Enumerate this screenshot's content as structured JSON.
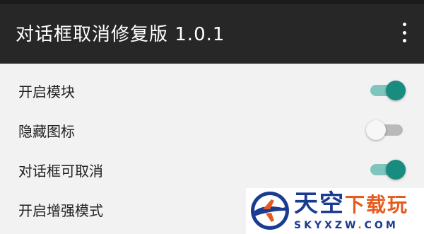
{
  "header": {
    "title": "对话框取消修复版 1.0.1",
    "overflow_icon": "more-vert-icon"
  },
  "settings": [
    {
      "label": "开启模块",
      "enabled": true
    },
    {
      "label": "隐藏图标",
      "enabled": false
    },
    {
      "label": "对话框可取消",
      "enabled": true
    },
    {
      "label": "开启增强模式",
      "enabled": null
    }
  ],
  "watermark": {
    "brand_cn_a": "天空",
    "brand_cn_b": "下载玩",
    "domain_a": "SKYXZW",
    "domain_dot": ".",
    "domain_b": "COM"
  },
  "colors": {
    "appbar": "#272727",
    "background": "#f2f2f2",
    "toggle_on_thumb": "#178c7f",
    "toggle_on_track": "#7fc5bd",
    "toggle_off_thumb": "#f7f7f7",
    "toggle_off_track": "#b9b9b9",
    "watermark_blue": "#1a3b8f",
    "watermark_orange": "#e65a1e"
  }
}
